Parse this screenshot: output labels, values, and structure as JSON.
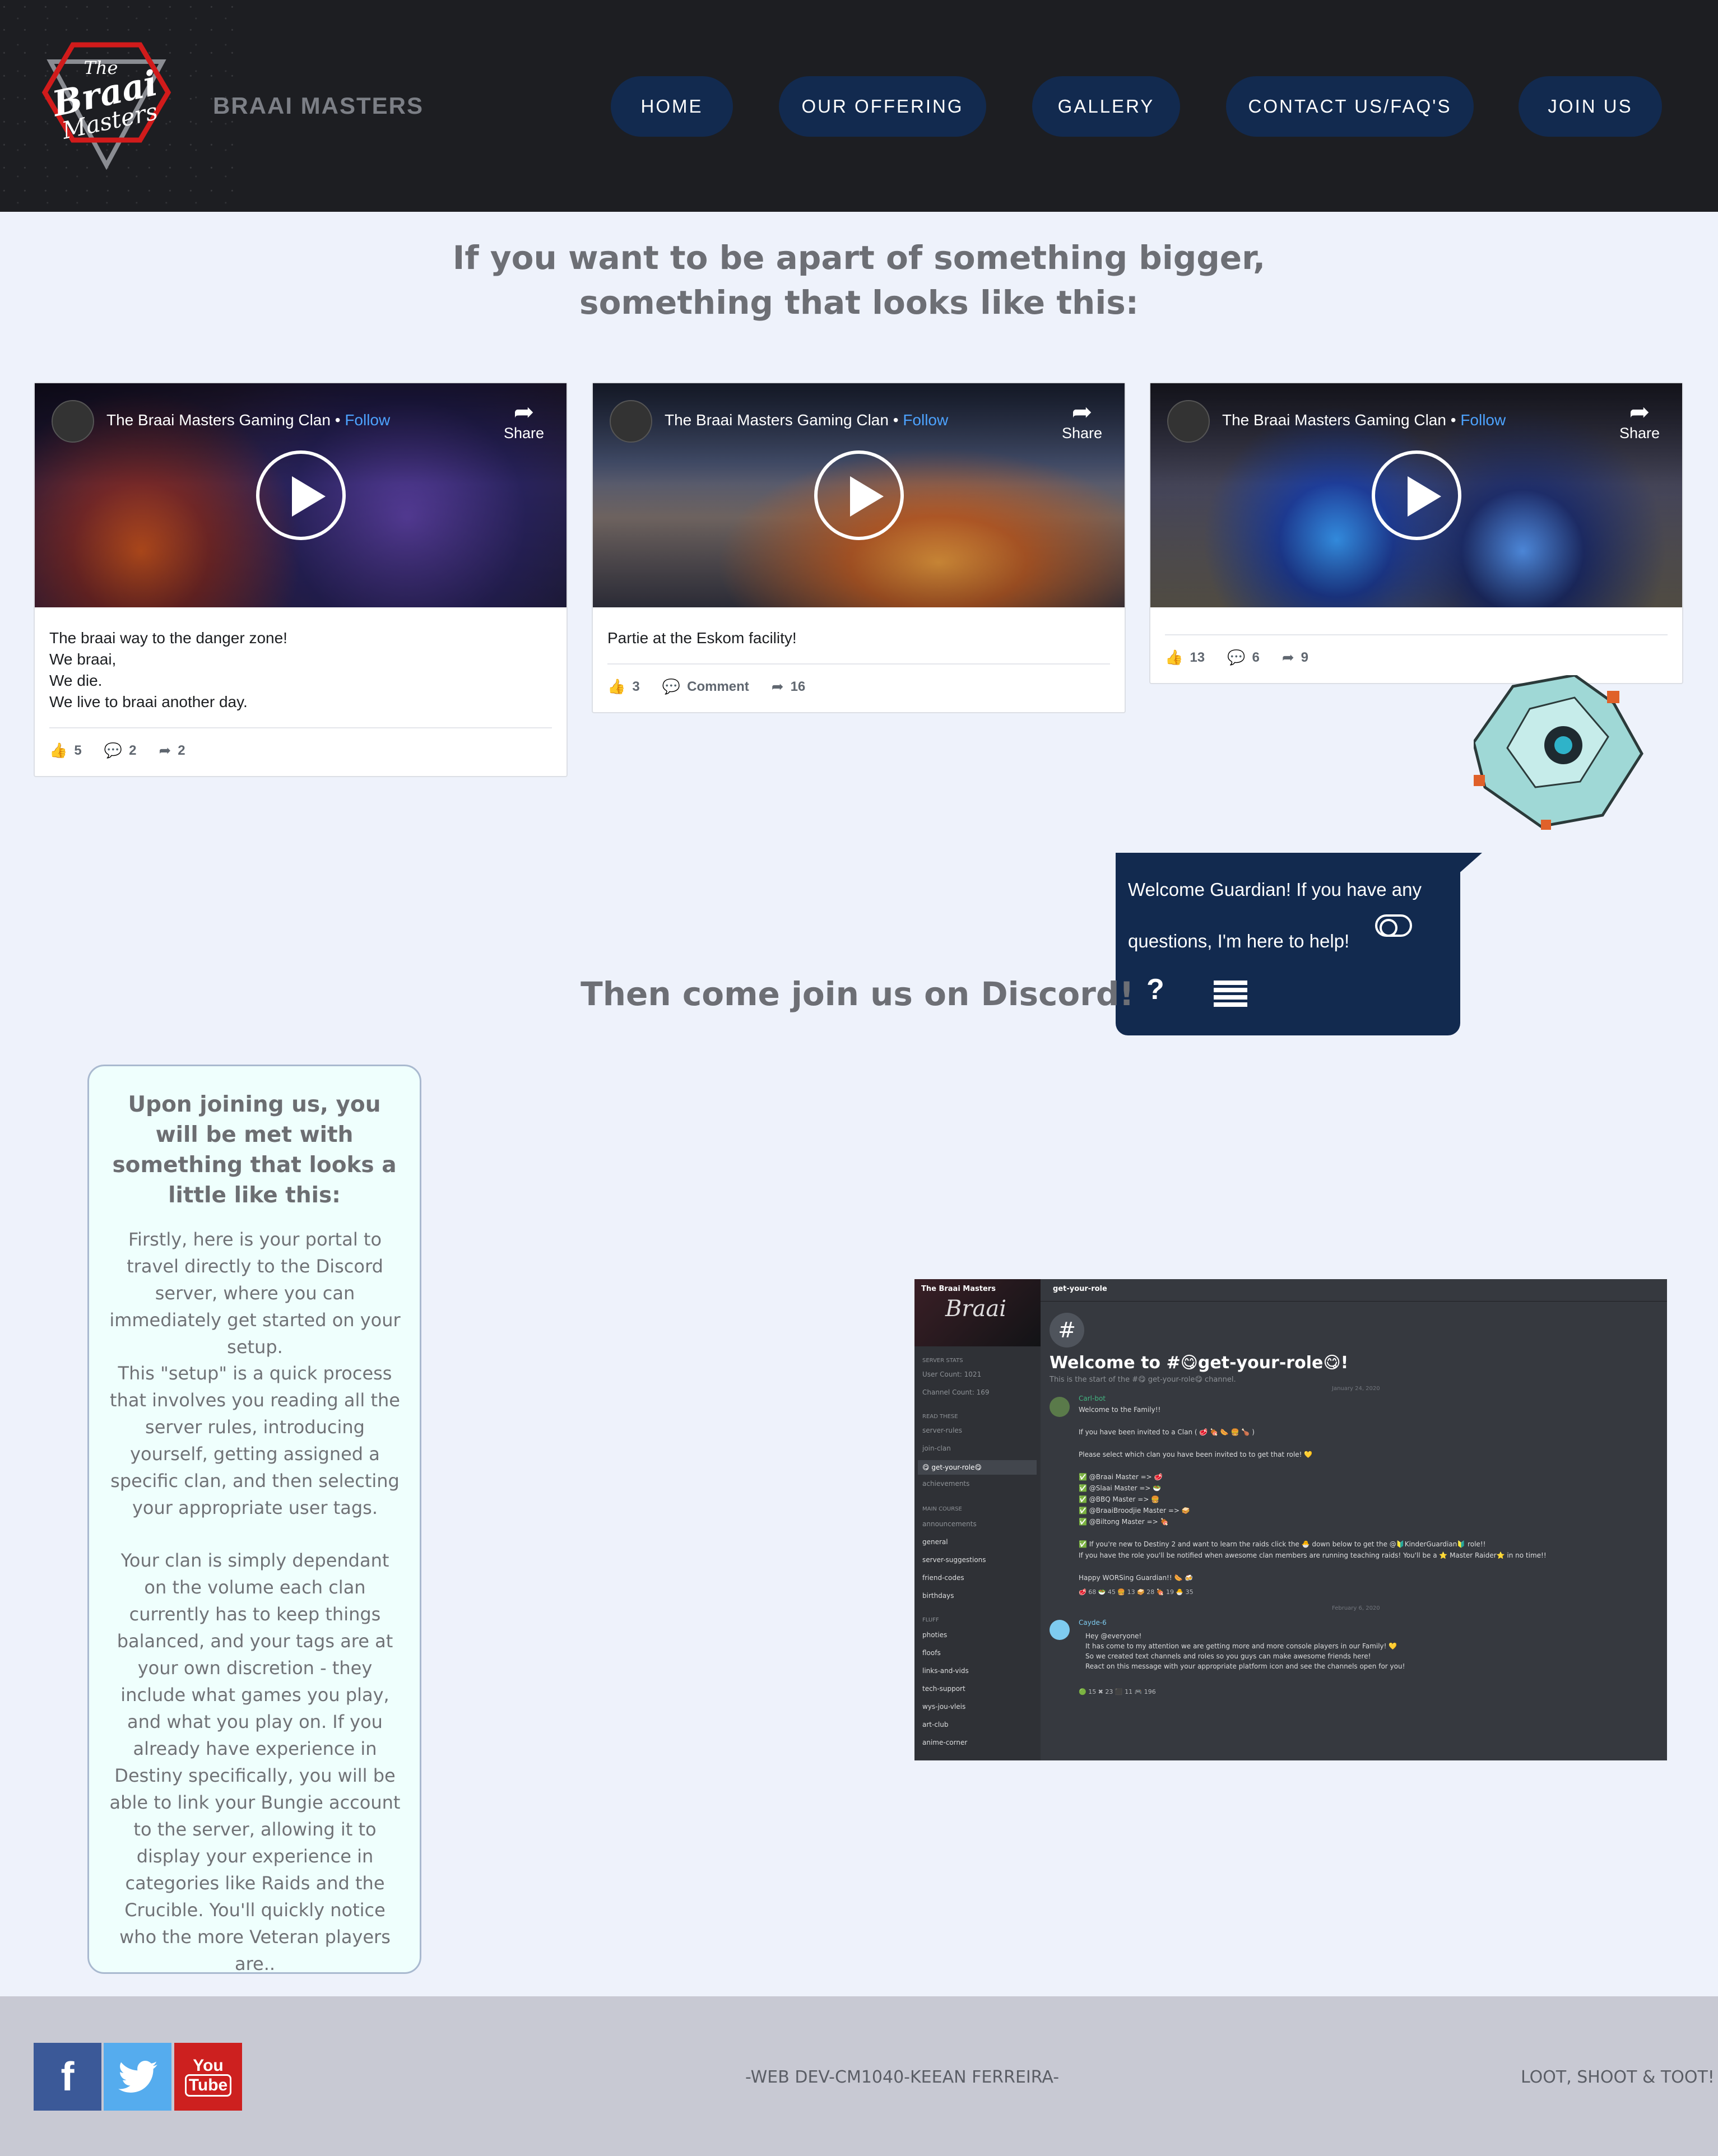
{
  "header": {
    "brand": "BRAAI MASTERS",
    "logo_text_line1": "The",
    "logo_text_line2": "Braai",
    "logo_text_line3": "Masters",
    "nav": [
      "HOME",
      "OUR OFFERING",
      "GALLERY",
      "CONTACT US/FAQ'S",
      "JOIN US"
    ]
  },
  "intro": {
    "title_line1": "If you want to be apart of something bigger,",
    "title_line2": "something that looks like this:"
  },
  "videos": [
    {
      "page_name": "The Braai Masters Gaming Clan",
      "follow": "Follow",
      "share": "Share",
      "caption_lines": [
        "The braai way to the danger zone!",
        "We braai,",
        "We die.",
        "We live to braai another day."
      ],
      "likes": "5",
      "comments": "2",
      "shares": "2"
    },
    {
      "page_name": "The Braai Masters Gaming Clan",
      "follow": "Follow",
      "share": "Share",
      "caption_lines": [
        "Partie at the Eskom facility!"
      ],
      "likes": "3",
      "comments_label": "Comment",
      "shares": "16"
    },
    {
      "page_name": "The Braai Masters Gaming Clan",
      "follow": "Follow",
      "share": "Share",
      "caption_lines": [],
      "likes": "13",
      "comments": "6",
      "shares": "9"
    }
  ],
  "chat": {
    "message": "Welcome Guardian! If you have any questions, I'm here to help!",
    "help_icon": "?"
  },
  "discord_section": {
    "title": "Then come join us on Discord!"
  },
  "info": {
    "heading": "Upon joining us, you will be met with something that looks a little like this:",
    "para1": "Firstly, here is your portal to travel directly to the Discord server, where you can immediately get started on your setup.",
    "para2": "This \"setup\" is a quick process that involves you reading all the server rules, introducing yourself, getting assigned a specific clan, and then selecting your appropriate user tags.",
    "para3": "Your clan is simply dependant on the volume each clan currently has to keep things balanced, and your tags are at your own discretion - they include what games you play, and what you play on. If you already have experience in Destiny specifically, you will be able to link your Bungie account to the server, allowing it to display your experience in categories like Raids and the Crucible. You'll quickly notice who the more Veteran players are.."
  },
  "discord": {
    "server": "The Braai Masters",
    "channel_header": "get-your-role",
    "welcome": "Welcome to #😋get-your-role😋!",
    "start_text": "This is the start of the #😋 get-your-role😋 channel.",
    "channels": [
      {
        "label": "SERVER STATS",
        "kind": "cat"
      },
      {
        "label": "User Count: 1021",
        "kind": "ch"
      },
      {
        "label": "Channel Count: 169",
        "kind": "ch"
      },
      {
        "label": "READ THESE",
        "kind": "cat"
      },
      {
        "label": "server-rules",
        "kind": "ch"
      },
      {
        "label": "join-clan",
        "kind": "ch"
      },
      {
        "label": "😋 get-your-role😋",
        "kind": "sel"
      },
      {
        "label": "achievements",
        "kind": "ch"
      },
      {
        "label": "MAIN COURSE",
        "kind": "cat"
      },
      {
        "label": "announcements",
        "kind": "ch"
      },
      {
        "label": "general",
        "kind": "bright"
      },
      {
        "label": "server-suggestions",
        "kind": "bright"
      },
      {
        "label": "friend-codes",
        "kind": "bright"
      },
      {
        "label": "birthdays",
        "kind": "bright"
      },
      {
        "label": "FLUFF",
        "kind": "cat"
      },
      {
        "label": "photies",
        "kind": "bright"
      },
      {
        "label": "floofs",
        "kind": "bright"
      },
      {
        "label": "links-and-vids",
        "kind": "bright"
      },
      {
        "label": "tech-support",
        "kind": "bright"
      },
      {
        "label": "wys-jou-vleis",
        "kind": "bright"
      },
      {
        "label": "art-club",
        "kind": "bright"
      },
      {
        "label": "anime-corner",
        "kind": "bright"
      }
    ],
    "date1": "January 24, 2020",
    "author1": "Carl-bot",
    "messages": [
      "Welcome to the Family!!",
      "If you have been invited to a Clan ( 🥩 🍖 🌭 🍔 🍗 )",
      "Please select which clan you have been invited to to get that role! 💛",
      "✅ @Braai Master  => 🥩",
      "✅ @Slaai Master  => 🥗",
      "✅ @BBQ Master  => 🍔",
      "✅ @BraaiBroodjie Master  => 🥪",
      "✅ @Biltong Master  => 🍖",
      "✅ If you're new to Destiny 2 and want to learn the raids click the 🐣 down below to get the @🔰KinderGuardian🔰 role!!",
      "If you have the role you'll be notified when awesome clan members are running teaching raids! You'll be a ⭐ Master Raider⭐ in no time!!",
      "Happy WORSing Guardian!! 🌭 🍻"
    ],
    "reactions1": "🥩 68  🥗 45  🍔 13  🥪 28  🍖 19  🐣 35",
    "date2": "February 6, 2020",
    "author2": "Cayde-6",
    "embed_lines": [
      "Hey @everyone!",
      "It has come to my attention we are getting more and more console players in our Family! 💛",
      "So we created text channels and roles so you guys can make awesome friends here!",
      "React on this message with your appropriate platform icon and see the channels open for you!"
    ],
    "reactions2": "🟢 15   ✖ 23   ⬛ 11   🎮 196"
  },
  "footer": {
    "credit": "-WEB DEV-CM1040-KEEAN FERREIRA-",
    "slogan": "LOOT, SHOOT & TOOT!",
    "youtube_label_top": "You",
    "youtube_label_bottom": "Tube"
  },
  "colors": {
    "nav_bg": "#122a4f",
    "header_bg": "#1d1e22",
    "page_bg": "#eef2fb",
    "footer_bg": "#c8c9d3",
    "facebook": "#3b5998",
    "twitter": "#55acee",
    "youtube": "#cd201f"
  }
}
